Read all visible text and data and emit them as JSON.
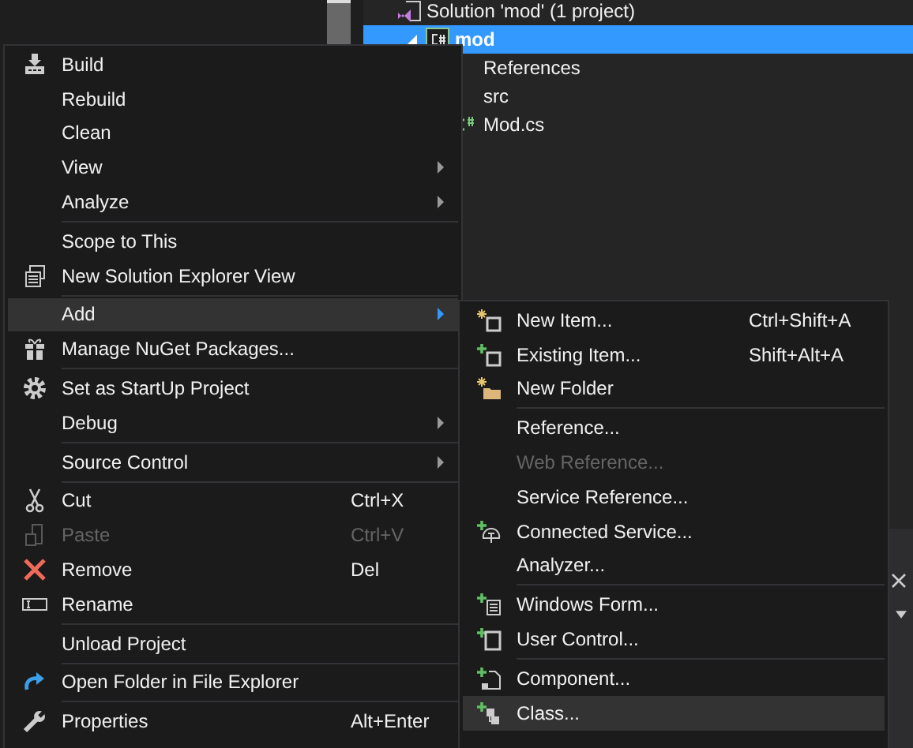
{
  "tree": [
    {
      "label": "Solution 'mod' (1 project)",
      "kind": "solution",
      "selected": false,
      "children": [
        {
          "label": "mod",
          "kind": "project",
          "selected": true,
          "expanded": true,
          "children": [
            {
              "label": "References",
              "kind": "folder",
              "selected": false
            },
            {
              "label": "src",
              "kind": "folder",
              "selected": false
            },
            {
              "label": "Mod.cs",
              "kind": "file",
              "selected": false
            }
          ]
        }
      ]
    }
  ],
  "context_menu": {
    "sections": [
      [
        {
          "label": "Build",
          "submenu": false,
          "selected": false,
          "disabled": false
        },
        {
          "label": "Rebuild",
          "submenu": false,
          "selected": false,
          "disabled": false
        },
        {
          "label": "Clean",
          "submenu": false,
          "selected": false,
          "disabled": false
        },
        {
          "label": "View",
          "submenu": true,
          "selected": false,
          "disabled": false
        },
        {
          "label": "Analyze",
          "submenu": true,
          "selected": false,
          "disabled": false
        }
      ],
      [
        {
          "label": "Scope to This",
          "submenu": false,
          "selected": false,
          "disabled": false
        },
        {
          "label": "New Solution Explorer View",
          "submenu": false,
          "selected": false,
          "disabled": false
        }
      ],
      [
        {
          "label": "Add",
          "submenu": true,
          "selected": true,
          "disabled": false
        },
        {
          "label": "Manage NuGet Packages...",
          "submenu": false,
          "selected": false,
          "disabled": false
        }
      ],
      [
        {
          "label": "Set as StartUp Project",
          "submenu": false,
          "selected": false,
          "disabled": false
        },
        {
          "label": "Debug",
          "submenu": true,
          "selected": false,
          "disabled": false
        }
      ],
      [
        {
          "label": "Source Control",
          "submenu": true,
          "selected": false,
          "disabled": false
        }
      ],
      [
        {
          "label": "Cut",
          "shortcut": "Ctrl+X",
          "submenu": false,
          "selected": false,
          "disabled": false
        },
        {
          "label": "Paste",
          "shortcut": "Ctrl+V",
          "submenu": false,
          "selected": false,
          "disabled": true
        },
        {
          "label": "Remove",
          "shortcut": "Del",
          "submenu": false,
          "selected": false,
          "disabled": false
        },
        {
          "label": "Rename",
          "submenu": false,
          "selected": false,
          "disabled": false
        }
      ],
      [
        {
          "label": "Unload Project",
          "submenu": false,
          "selected": false,
          "disabled": false
        }
      ],
      [
        {
          "label": "Open Folder in File Explorer",
          "submenu": false,
          "selected": false,
          "disabled": false
        }
      ],
      [
        {
          "label": "Properties",
          "shortcut": "Alt+Enter",
          "submenu": false,
          "selected": false,
          "disabled": false
        }
      ]
    ]
  },
  "add_submenu": {
    "sections": [
      [
        {
          "label": "New Item...",
          "shortcut": "Ctrl+Shift+A",
          "selected": false,
          "disabled": false
        },
        {
          "label": "Existing Item...",
          "shortcut": "Shift+Alt+A",
          "selected": false,
          "disabled": false
        },
        {
          "label": "New Folder",
          "selected": false,
          "disabled": false
        }
      ],
      [
        {
          "label": "Reference...",
          "selected": false,
          "disabled": false
        },
        {
          "label": "Web Reference...",
          "selected": false,
          "disabled": true
        },
        {
          "label": "Service Reference...",
          "selected": false,
          "disabled": false
        },
        {
          "label": "Connected Service...",
          "selected": false,
          "disabled": false
        },
        {
          "label": "Analyzer...",
          "selected": false,
          "disabled": false
        }
      ],
      [
        {
          "label": "Windows Form...",
          "selected": false,
          "disabled": false
        },
        {
          "label": "User Control...",
          "selected": false,
          "disabled": false
        }
      ],
      [
        {
          "label": "Component...",
          "selected": false,
          "disabled": false
        },
        {
          "label": "Class...",
          "selected": true,
          "disabled": false
        }
      ]
    ]
  }
}
